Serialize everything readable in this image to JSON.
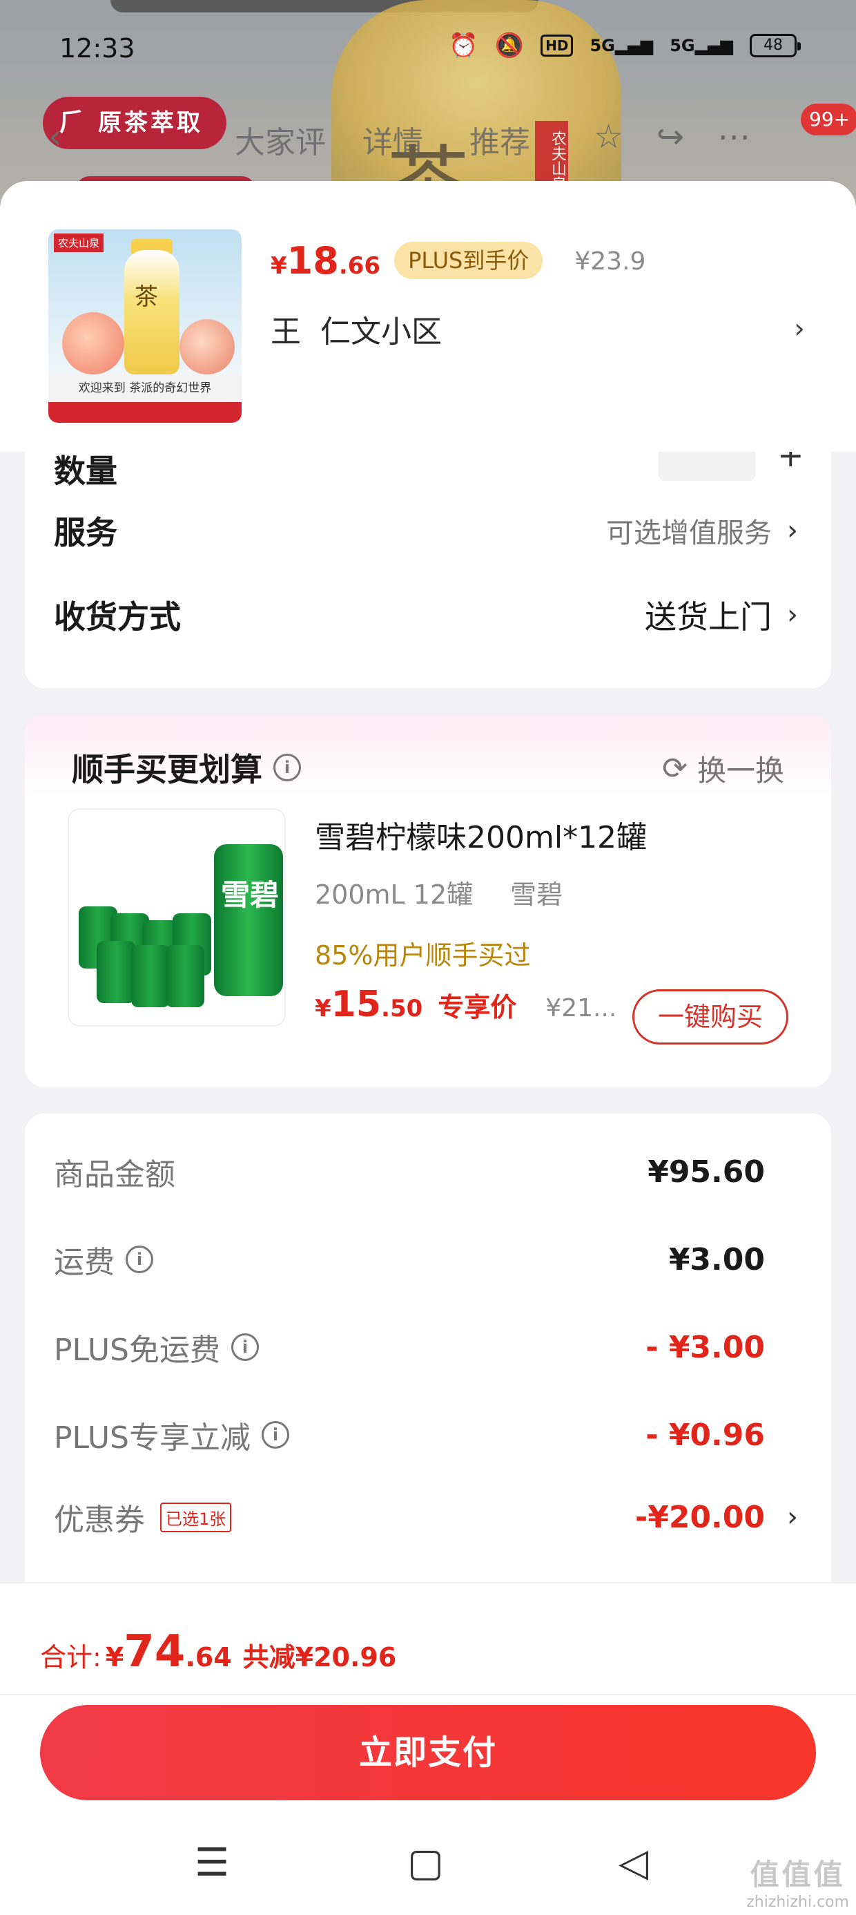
{
  "status_bar": {
    "time": "12:33",
    "battery": "48",
    "hd_label": "HD",
    "net1": "5G",
    "net2": "5G"
  },
  "background": {
    "pill_label": "原茶萃取",
    "tab_reviews": "大家评",
    "tab_details": "详情",
    "tab_recommend": "推荐",
    "badge": "99+",
    "tea_char": "茶",
    "brand": "农夫山泉"
  },
  "product": {
    "thumb_brand": "农夫山泉",
    "thumb_tea": "茶",
    "thumb_caption": "欢迎来到 茶派的奇幻世界",
    "currency": "¥",
    "price_int": "18",
    "price_dec": ".66",
    "plus_tag": "PLUS到手价",
    "orig_price": "¥23.9"
  },
  "address": {
    "name": "王",
    "text": "仁文小区"
  },
  "options": {
    "qty_label": "数量",
    "service_label": "服务",
    "service_value": "可选增值服务",
    "delivery_label": "收货方式",
    "delivery_value": "送货上门"
  },
  "addon": {
    "title": "顺手买更划算",
    "swap_label": "换一换",
    "can_text": "雪碧",
    "product_name": "雪碧柠檬味200ml*12罐",
    "spec1": "200mL 12罐",
    "spec2": "雪碧",
    "percent": "85%用户顺手买过",
    "currency": "¥",
    "price_int": "15",
    "price_dec": ".50",
    "exclusive": "专享价",
    "orig_price": "¥21...",
    "buy_button": "一键购买"
  },
  "summary": {
    "goods_label": "商品金额",
    "goods_value": "¥95.60",
    "shipping_label": "运费",
    "shipping_value": "¥3.00",
    "plus_free_label": "PLUS免运费",
    "plus_free_value": "- ¥3.00",
    "plus_cut_label": "PLUS专享立减",
    "plus_cut_value": "- ¥0.96",
    "coupon_label": "优惠券",
    "coupon_badge": "已选1张",
    "coupon_value": "-¥20.00"
  },
  "footer": {
    "total_label": "合计:",
    "currency": "¥",
    "total_int": "74",
    "total_dec": ".64",
    "saved": "共减¥20.96",
    "pay_button": "立即支付"
  },
  "watermark": {
    "big": "值值值",
    "small": "zhizhizhi.com"
  },
  "colors": {
    "accent_red": "#e1251b",
    "plus_gold": "#fbe3a8",
    "pay_button": "#f03a47"
  }
}
